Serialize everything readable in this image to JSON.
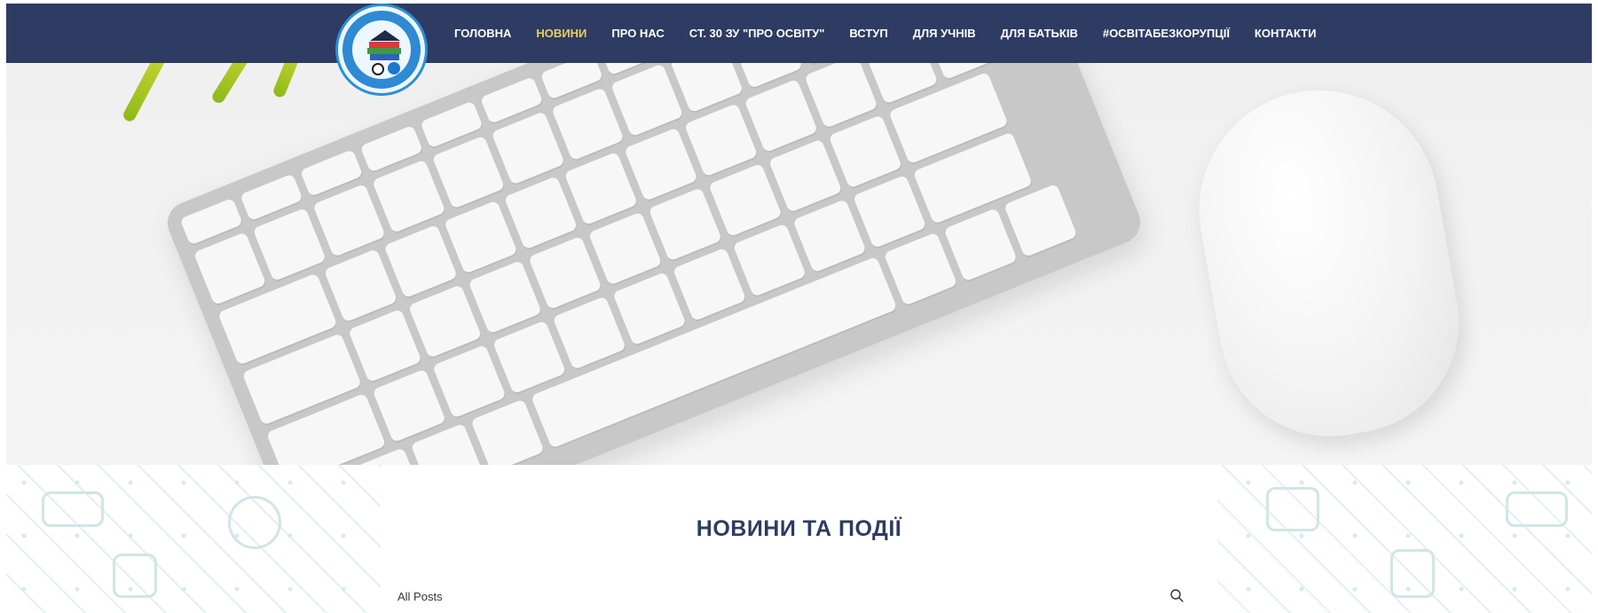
{
  "nav": {
    "logo_icon": "school-logo-icon",
    "items": [
      {
        "label": "ГОЛОВНА",
        "active": false
      },
      {
        "label": "НОВИНИ",
        "active": true
      },
      {
        "label": "ПРО НАС",
        "active": false
      },
      {
        "label": "СТ. 30 ЗУ \"ПРО ОСВІТУ\"",
        "active": false
      },
      {
        "label": "ВСТУП",
        "active": false
      },
      {
        "label": "ДЛЯ УЧНІВ",
        "active": false
      },
      {
        "label": "ДЛЯ БАТЬКІВ",
        "active": false
      },
      {
        "label": "#ОСВІТАБЕЗКОРУПЦІЇ",
        "active": false
      },
      {
        "label": "КОНТАКТИ",
        "active": false
      }
    ],
    "colors": {
      "background": "#2e3c63",
      "text": "#ffffff",
      "active": "#e8d15a"
    }
  },
  "hero": {
    "image": "keyboard-and-mouse-photo"
  },
  "main": {
    "title": "НОВИНИ ТА ПОДІЇ",
    "filter_label": "All Posts",
    "search_icon": "search-icon",
    "title_color": "#2e3c63"
  }
}
